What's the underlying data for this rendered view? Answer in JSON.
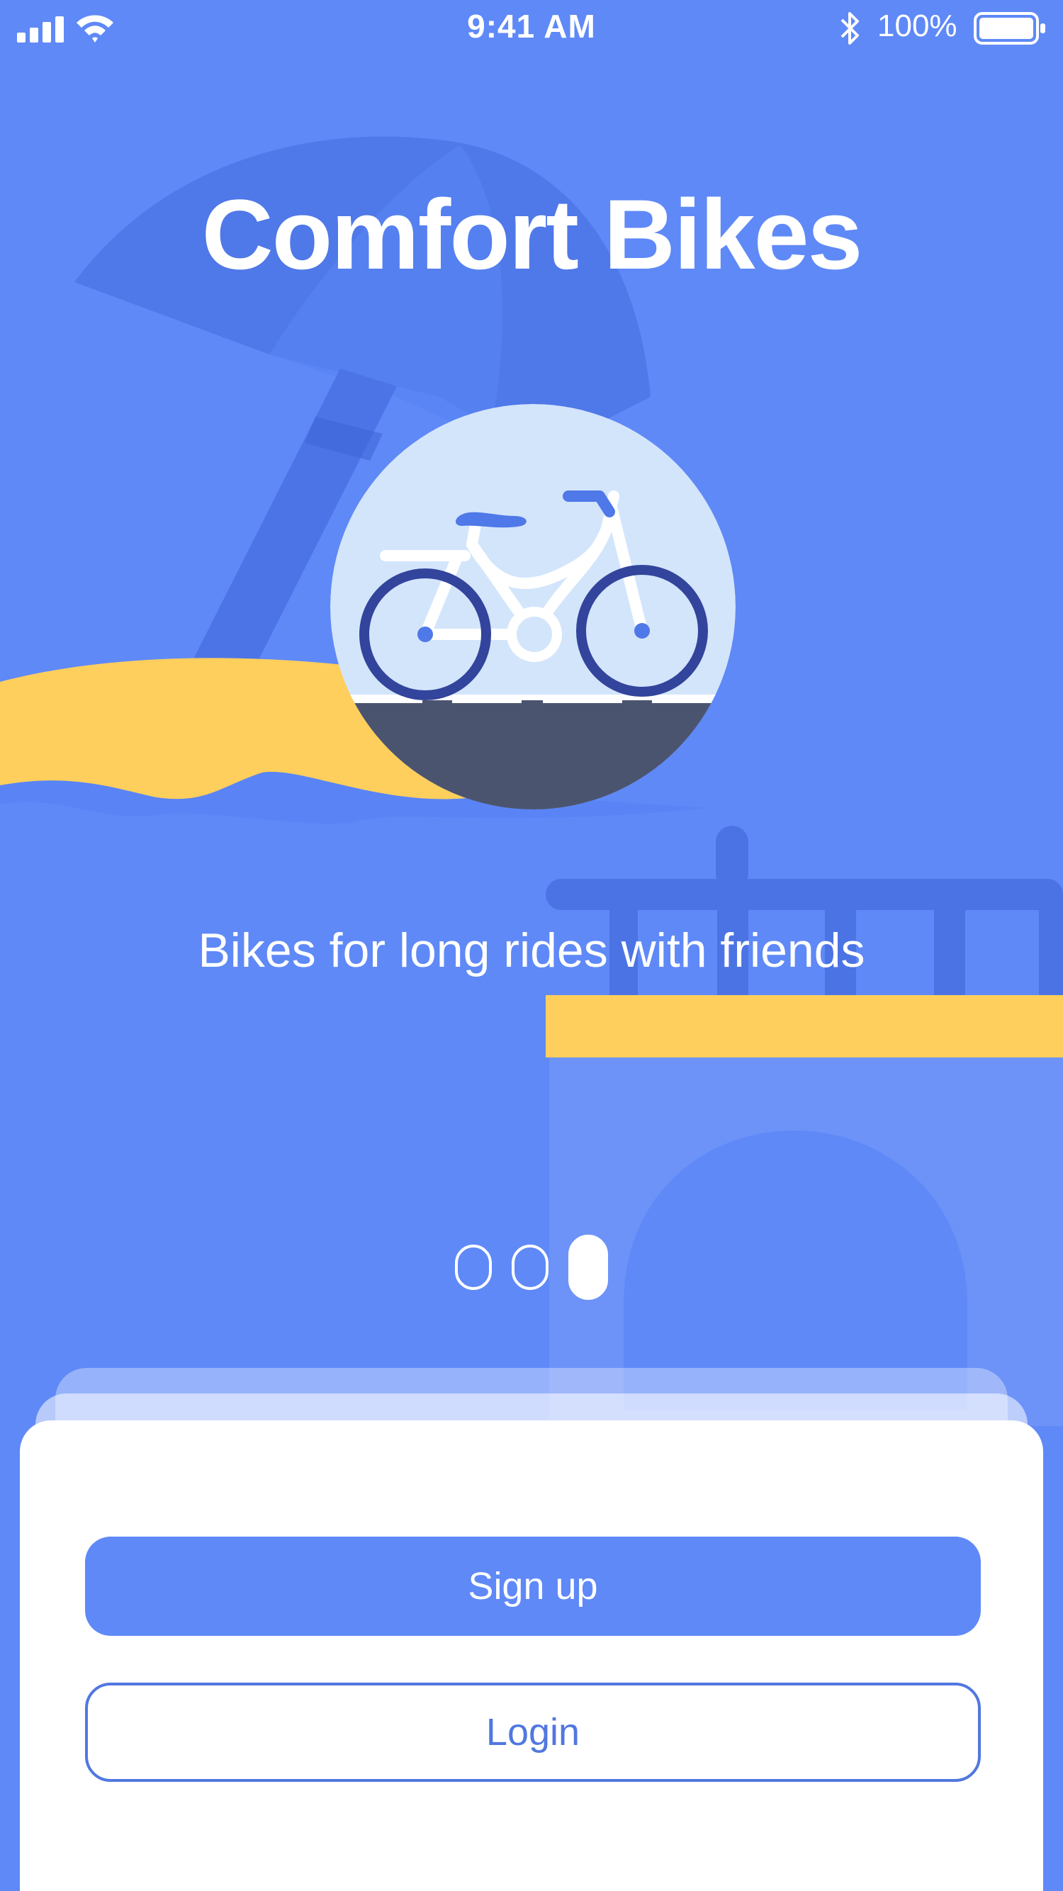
{
  "status_bar": {
    "time": "9:41 AM",
    "battery_percent": "100%",
    "battery_level": 1.0,
    "icons": [
      "signal-icon",
      "wifi-icon",
      "bluetooth-icon",
      "battery-icon"
    ]
  },
  "onboarding": {
    "title": "Comfort Bikes",
    "tagline": "Bikes for long rides with friends",
    "pages_total": 3,
    "current_page": 3
  },
  "actions": {
    "signup_label": "Sign up",
    "login_label": "Login"
  },
  "colors": {
    "background": "#5f89f7",
    "accent_yellow": "#fecf5c",
    "primary": "#5f89f7",
    "button_outline": "#5177e0",
    "hero_circle": "#d3e5fb",
    "road": "#4b546f"
  }
}
